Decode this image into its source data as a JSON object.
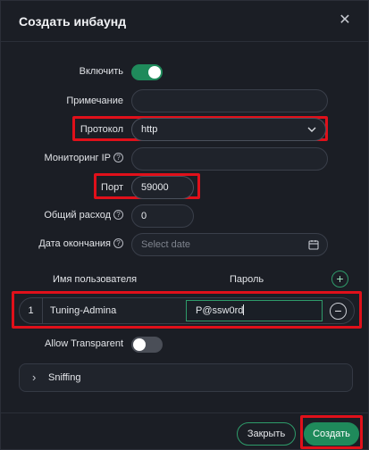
{
  "dialog": {
    "title": "Создать инбаунд",
    "close_label": "✕"
  },
  "form": {
    "enable_label": "Включить",
    "enable_value": true,
    "note_label": "Примечание",
    "note_value": "",
    "protocol_label": "Протокол",
    "protocol_value": "http",
    "monitor_ip_label": "Мониторинг IP",
    "monitor_ip_value": "",
    "port_label": "Порт",
    "port_value": "59000",
    "total_traffic_label": "Общий расход",
    "total_traffic_value": "0",
    "expiry_label": "Дата окончания",
    "expiry_placeholder": "Select date",
    "help_glyph": "?"
  },
  "accounts": {
    "username_header": "Имя пользователя",
    "password_header": "Пароль",
    "add_glyph": "+",
    "rows": [
      {
        "index": "1",
        "username": "Tuning-Admina",
        "password": "P@ssw0rd",
        "remove_glyph": "−"
      }
    ]
  },
  "allow_transparent": {
    "label": "Allow Transparent",
    "value": false
  },
  "sniffing": {
    "label": "Sniffing",
    "chevron": "›"
  },
  "footer": {
    "close_button": "Закрыть",
    "create_button": "Создать"
  },
  "colors": {
    "accent": "#1f8a5b",
    "highlight": "#e0101a",
    "background": "#1b1e25"
  }
}
